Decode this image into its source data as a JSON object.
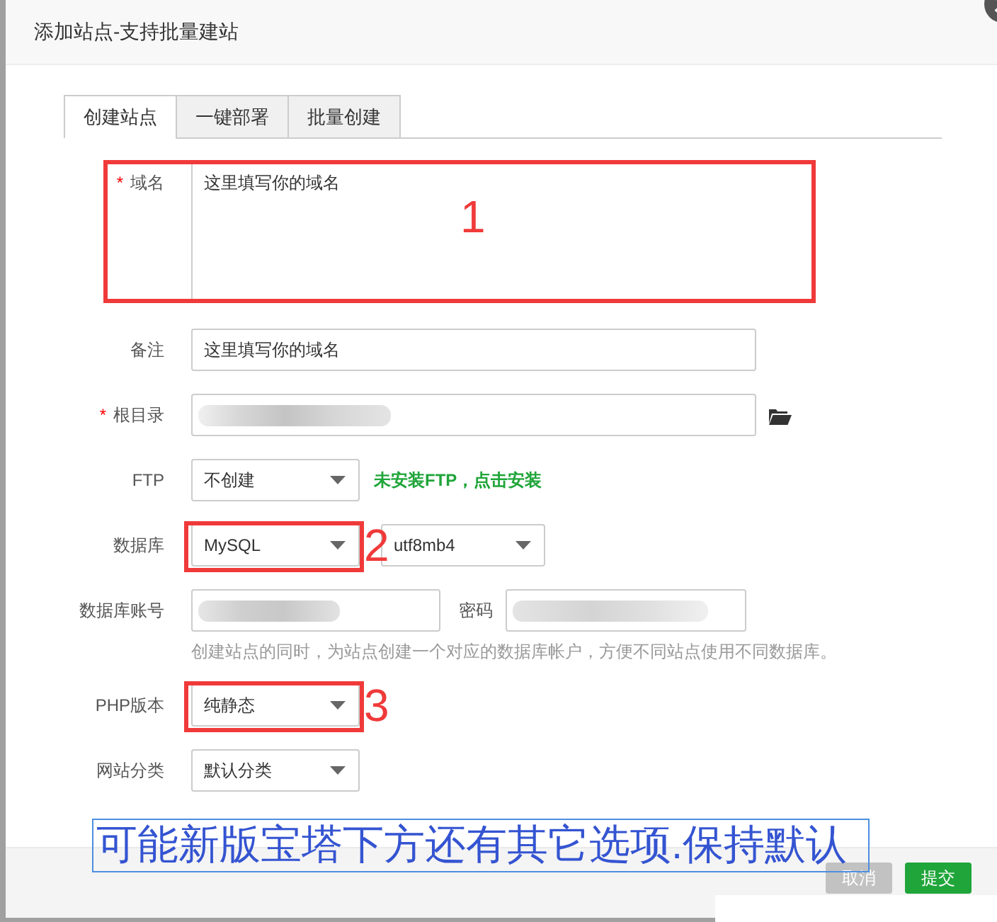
{
  "dialog": {
    "title": "添加站点-支持批量建站"
  },
  "tabs": [
    {
      "label": "创建站点",
      "selected": true
    },
    {
      "label": "一键部署",
      "selected": false
    },
    {
      "label": "批量创建",
      "selected": false
    }
  ],
  "form": {
    "rows": [
      {
        "kind": "textarea",
        "label": "域名",
        "required_mark": "*",
        "value": "这里填写你的域名",
        "annotation": {
          "kind": "row-box",
          "number": "1"
        }
      },
      {
        "kind": "input",
        "label": "备注",
        "value": "这里填写你的域名"
      },
      {
        "kind": "path",
        "label": "根目录",
        "required_mark": "*",
        "value_redacted": true
      },
      {
        "kind": "select",
        "label": "FTP",
        "value": "不创建",
        "note": "未安装FTP，点击安装"
      },
      {
        "kind": "select-pair",
        "label": "数据库",
        "value": "MySQL",
        "value_2": "utf8mb4",
        "annotation": {
          "kind": "field-box",
          "number": "2"
        }
      },
      {
        "kind": "credentials",
        "label": "数据库账号",
        "account_redacted": true,
        "password_label": "密码",
        "password_redacted": true,
        "hint": "创建站点的同时，为站点创建一个对应的数据库帐户，方便不同站点使用不同数据库。"
      },
      {
        "kind": "select",
        "label": "PHP版本",
        "value": "纯静态",
        "annotation": {
          "kind": "field-box",
          "number": "3"
        }
      },
      {
        "kind": "select",
        "label": "网站分类",
        "value": "默认分类"
      }
    ]
  },
  "callout": {
    "text": "可能新版宝塔下方还有其它选项.保持默认"
  },
  "footer": {
    "buttons": [
      {
        "label": "取消",
        "kind": "secondary"
      },
      {
        "label": "提交",
        "kind": "primary"
      }
    ]
  }
}
